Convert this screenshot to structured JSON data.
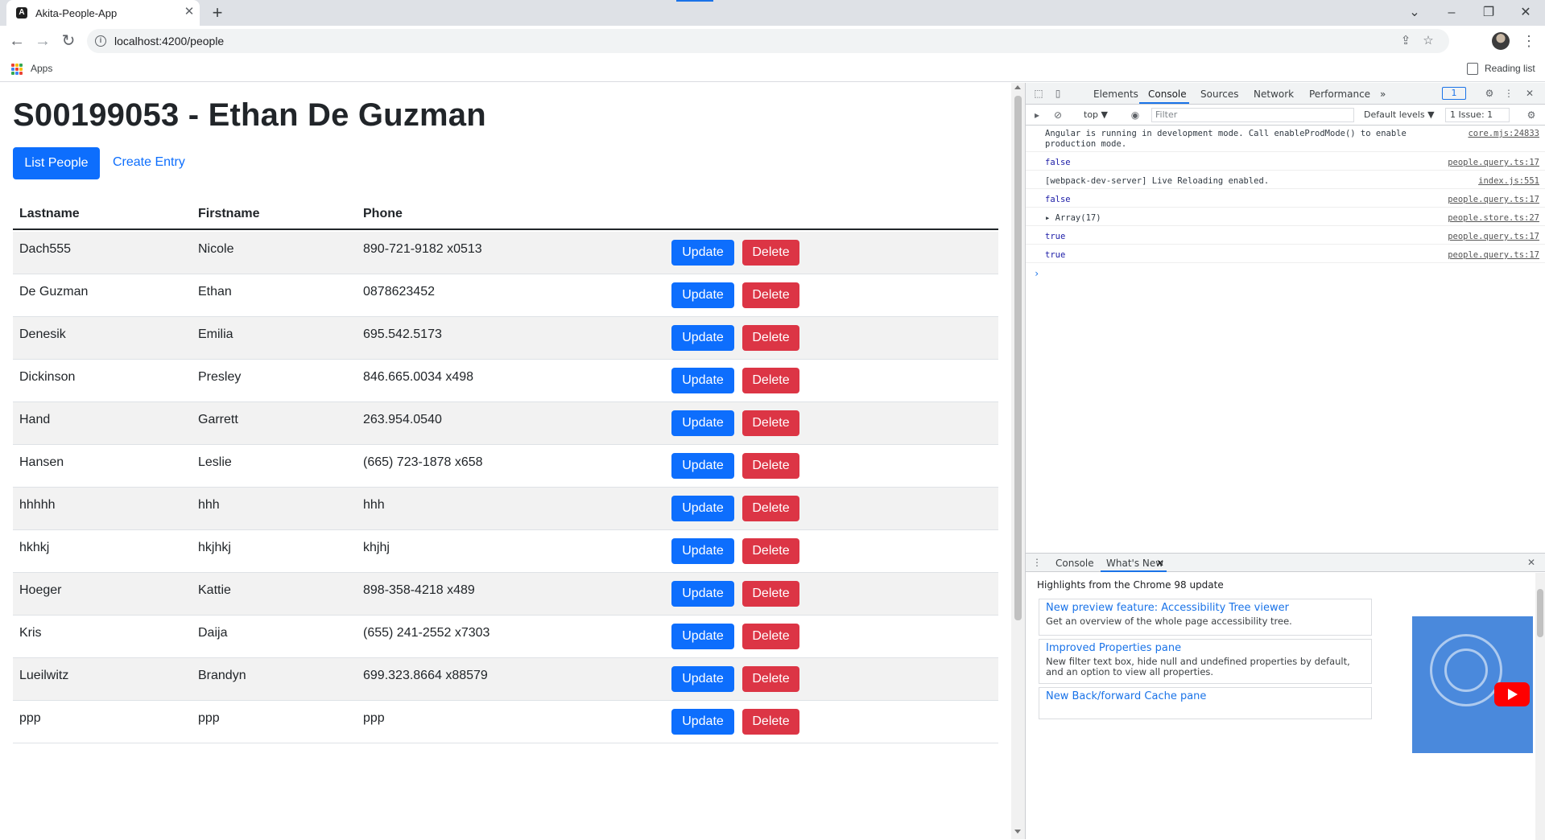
{
  "browser": {
    "tab_title": "Akita-People-App",
    "tab_favicon": "A",
    "url": "localhost:4200/people",
    "bookmarks": {
      "apps_label": "Apps",
      "reading_list_label": "Reading list"
    },
    "icons": {
      "close": "✕",
      "new_tab": "+",
      "back": "←",
      "forward": "→",
      "reload": "↻",
      "tab_search": "⌄",
      "minimize": "–",
      "restore": "❐",
      "window_close": "✕",
      "share": "⇪",
      "star": "☆",
      "menu": "⋮",
      "info": "i"
    }
  },
  "app": {
    "title": "S00199053 - Ethan De Guzman",
    "nav": {
      "list_people": "List People",
      "create_entry": "Create Entry"
    },
    "table": {
      "headers": {
        "lastname": "Lastname",
        "firstname": "Firstname",
        "phone": "Phone"
      },
      "update_label": "Update",
      "delete_label": "Delete",
      "rows": [
        {
          "lastname": "Dach555",
          "firstname": "Nicole",
          "phone": "890-721-9182 x0513"
        },
        {
          "lastname": "De Guzman",
          "firstname": "Ethan",
          "phone": "0878623452"
        },
        {
          "lastname": "Denesik",
          "firstname": "Emilia",
          "phone": "695.542.5173"
        },
        {
          "lastname": "Dickinson",
          "firstname": "Presley",
          "phone": "846.665.0034 x498"
        },
        {
          "lastname": "Hand",
          "firstname": "Garrett",
          "phone": "263.954.0540"
        },
        {
          "lastname": "Hansen",
          "firstname": "Leslie",
          "phone": "(665) 723-1878 x658"
        },
        {
          "lastname": "hhhhh",
          "firstname": "hhh",
          "phone": "hhh"
        },
        {
          "lastname": "hkhkj",
          "firstname": "hkjhkj",
          "phone": "khjhj"
        },
        {
          "lastname": "Hoeger",
          "firstname": "Kattie",
          "phone": "898-358-4218 x489"
        },
        {
          "lastname": "Kris",
          "firstname": "Daija",
          "phone": "(655) 241-2552 x7303"
        },
        {
          "lastname": "Lueilwitz",
          "firstname": "Brandyn",
          "phone": "699.323.8664 x88579"
        },
        {
          "lastname": "ppp",
          "firstname": "ppp",
          "phone": "ppp"
        }
      ]
    }
  },
  "devtools": {
    "tabs": [
      "Elements",
      "Console",
      "Sources",
      "Network",
      "Performance"
    ],
    "more_tabs": "»",
    "issue_badge": "1",
    "context": "top ▼",
    "filter_placeholder": "Filter",
    "levels": "Default levels ▼",
    "issues_button": "1 Issue: 1",
    "logs": [
      {
        "msg": "Angular is running in development mode. Call enableProdMode() to enable\nproduction mode.",
        "src": "core.mjs:24833",
        "kind": "text"
      },
      {
        "msg": "false",
        "src": "people.query.ts:17",
        "kind": "bool"
      },
      {
        "msg": "[webpack-dev-server] Live Reloading enabled.",
        "src": "index.js:551",
        "kind": "text"
      },
      {
        "msg": "false",
        "src": "people.query.ts:17",
        "kind": "bool"
      },
      {
        "msg": "▸ Array(17)",
        "src": "people.store.ts:27",
        "kind": "text"
      },
      {
        "msg": "true",
        "src": "people.query.ts:17",
        "kind": "bool"
      },
      {
        "msg": "true",
        "src": "people.query.ts:17",
        "kind": "bool"
      }
    ],
    "prompt": "›",
    "drawer": {
      "tabs": [
        "Console",
        "What's New"
      ],
      "header": "Highlights from the Chrome 98 update",
      "cards": [
        {
          "title": "New preview feature: Accessibility Tree viewer",
          "desc": "Get an overview of the whole page accessibility tree."
        },
        {
          "title": "Improved Properties pane",
          "desc": "New filter text box, hide null and undefined properties by default, and an option to view all properties."
        },
        {
          "title": "New Back/forward Cache pane",
          "desc": ""
        }
      ]
    },
    "colors": {
      "accent": "#1a73e8"
    }
  },
  "colors": {
    "primary": "#0d6efd",
    "danger": "#dc3545",
    "text": "#212529"
  }
}
